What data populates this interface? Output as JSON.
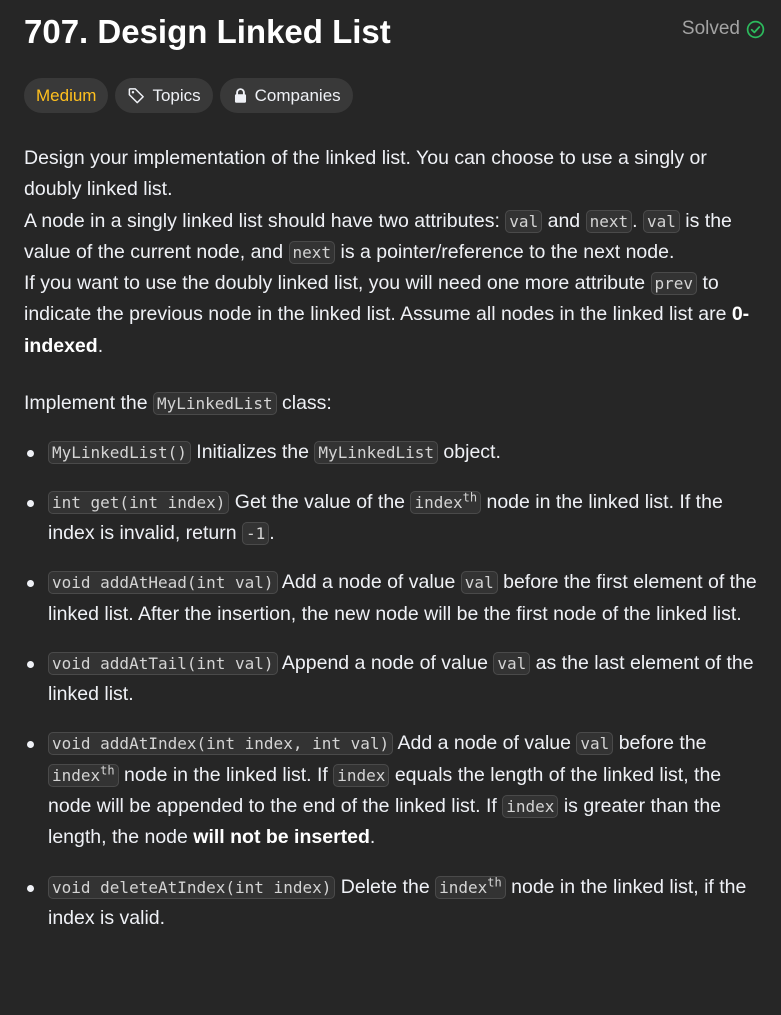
{
  "problem": {
    "title": "707. Design Linked List",
    "status": "Solved",
    "difficulty": "Medium",
    "topics_label": "Topics",
    "companies_label": "Companies"
  },
  "colors": {
    "difficulty_medium": "#ffc01e",
    "solved_check": "#2cbb5d",
    "background": "#262626"
  },
  "icons": {
    "solved": "check-circle-icon",
    "topics": "tag-icon",
    "companies": "lock-icon"
  },
  "description": {
    "p1": {
      "t1": "Design your implementation of the linked list. You can choose to use a singly or doubly linked list."
    },
    "p2": {
      "t1": "A node in a singly linked list should have two attributes: ",
      "c1": "val",
      "t2": " and ",
      "c2": "next",
      "t3": ". ",
      "c3": "val",
      "t4": " is the value of the current node, and ",
      "c4": "next",
      "t5": " is a pointer/reference to the next node."
    },
    "p3": {
      "t1": "If you want to use the doubly linked list, you will need one more attribute ",
      "c1": "prev",
      "t2": " to indicate the previous node in the linked list. Assume all nodes in the linked list are ",
      "b1": "0-indexed",
      "t3": "."
    },
    "p4": {
      "t1": "Implement the ",
      "c1": "MyLinkedList",
      "t2": " class:"
    }
  },
  "methods": [
    {
      "sig": "MyLinkedList()",
      "t1": " Initializes the ",
      "c1": "MyLinkedList",
      "t2": " object."
    },
    {
      "sig": "int get(int index)",
      "t1": " Get the value of the ",
      "c1": "index",
      "sup1": "th",
      "t2": " node in the linked list. If the index is invalid, return ",
      "c2": "-1",
      "t3": "."
    },
    {
      "sig": "void addAtHead(int val)",
      "t1": " Add a node of value ",
      "c1": "val",
      "t2": " before the first element of the linked list. After the insertion, the new node will be the first node of the linked list."
    },
    {
      "sig": "void addAtTail(int val)",
      "t1": " Append a node of value ",
      "c1": "val",
      "t2": " as the last element of the linked list."
    },
    {
      "sig": "void addAtIndex(int index, int val)",
      "t1": " Add a node of value ",
      "c1": "val",
      "t2": " before the ",
      "c2": "index",
      "sup1": "th",
      "t3": " node in the linked list. If ",
      "c3": "index",
      "t4": " equals the length of the linked list, the node will be appended to the end of the linked list. If ",
      "c4": "index",
      "t5": " is greater than the length, the node ",
      "b1": "will not be inserted",
      "t6": "."
    },
    {
      "sig": "void deleteAtIndex(int index)",
      "t1": " Delete the ",
      "c1": "index",
      "sup1": "th",
      "t2": " node in the linked list, if the index is valid."
    }
  ]
}
